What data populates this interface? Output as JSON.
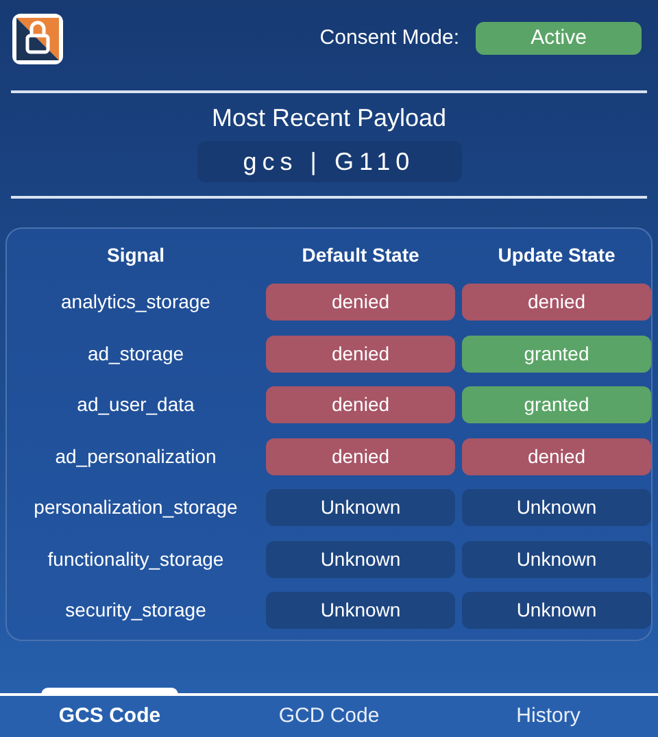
{
  "header": {
    "consent_label": "Consent Mode:",
    "consent_status": {
      "label": "Active",
      "kind": "granted"
    }
  },
  "payload": {
    "title": "Most Recent Payload",
    "value": "gcs | G110"
  },
  "table": {
    "columns": [
      "Signal",
      "Default State",
      "Update State"
    ],
    "rows": [
      {
        "signal": "analytics_storage",
        "default": {
          "label": "denied",
          "kind": "denied"
        },
        "update": {
          "label": "denied",
          "kind": "denied"
        }
      },
      {
        "signal": "ad_storage",
        "default": {
          "label": "denied",
          "kind": "denied"
        },
        "update": {
          "label": "granted",
          "kind": "granted"
        }
      },
      {
        "signal": "ad_user_data",
        "default": {
          "label": "denied",
          "kind": "denied"
        },
        "update": {
          "label": "granted",
          "kind": "granted"
        }
      },
      {
        "signal": "ad_personalization",
        "default": {
          "label": "denied",
          "kind": "denied"
        },
        "update": {
          "label": "denied",
          "kind": "denied"
        }
      },
      {
        "signal": "personalization_storage",
        "default": {
          "label": "Unknown",
          "kind": "unknown"
        },
        "update": {
          "label": "Unknown",
          "kind": "unknown"
        }
      },
      {
        "signal": "functionality_storage",
        "default": {
          "label": "Unknown",
          "kind": "unknown"
        },
        "update": {
          "label": "Unknown",
          "kind": "unknown"
        }
      },
      {
        "signal": "security_storage",
        "default": {
          "label": "Unknown",
          "kind": "unknown"
        },
        "update": {
          "label": "Unknown",
          "kind": "unknown"
        }
      }
    ]
  },
  "tabs": [
    {
      "label": "GCS Code",
      "selected": true
    },
    {
      "label": "GCD Code",
      "selected": false
    },
    {
      "label": "History",
      "selected": false
    }
  ]
}
